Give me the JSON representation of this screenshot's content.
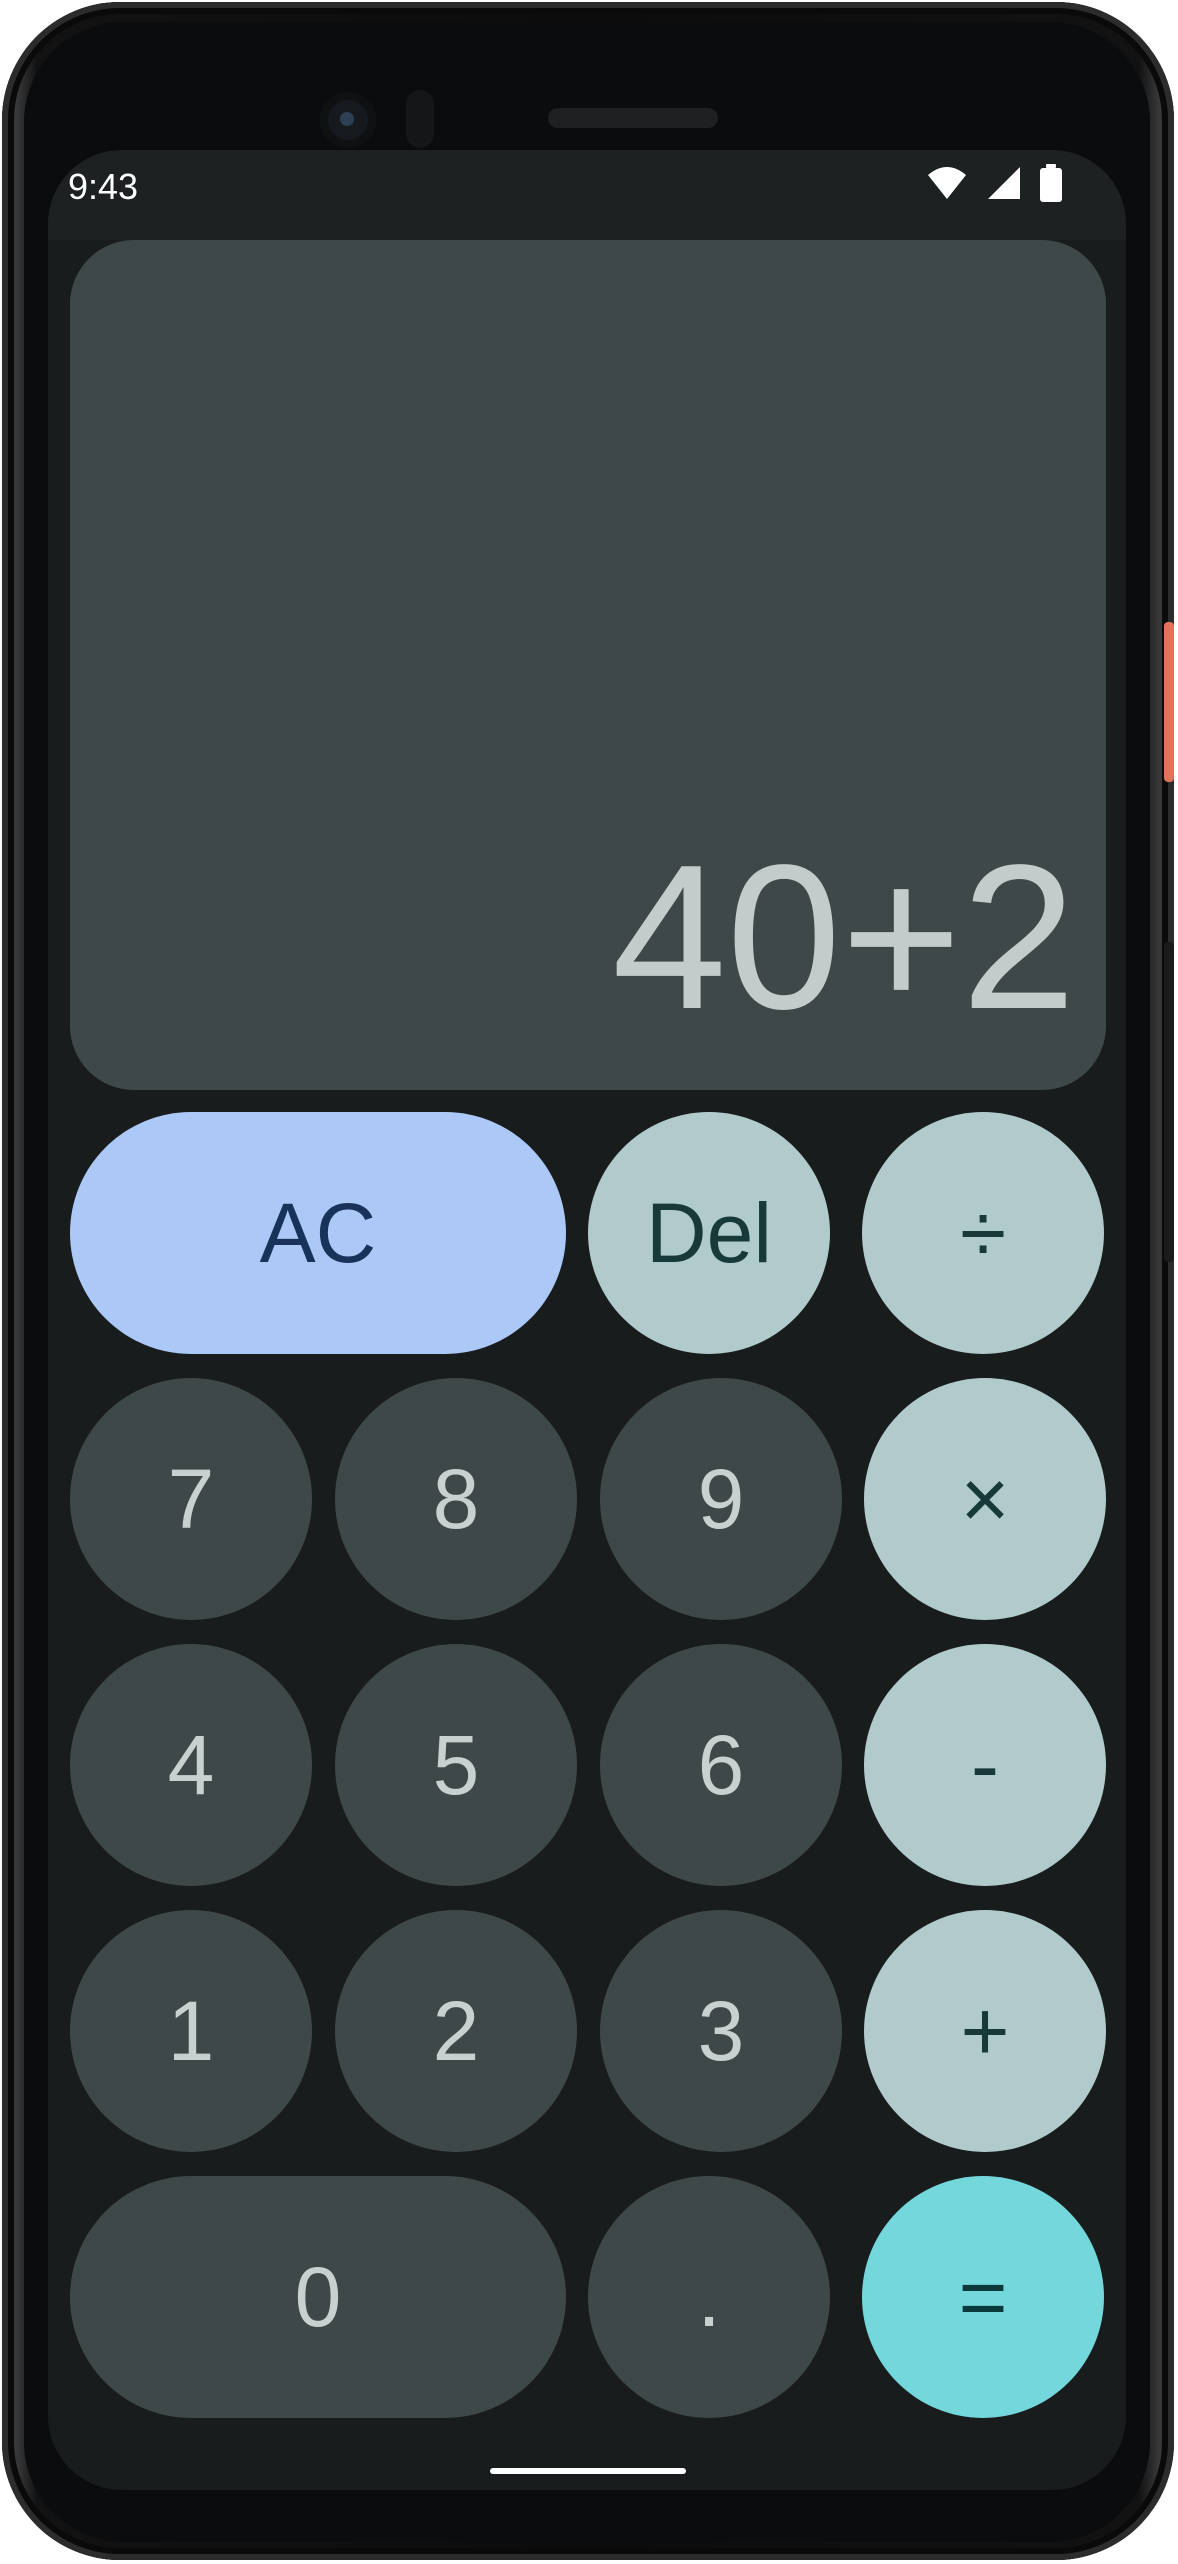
{
  "status_bar": {
    "time": "9:43",
    "icons": [
      "wifi-icon",
      "signal-icon",
      "battery-icon"
    ]
  },
  "display": {
    "expression": "40+2"
  },
  "keypad": {
    "ac": "AC",
    "del": "Del",
    "divide": "÷",
    "seven": "7",
    "eight": "8",
    "nine": "9",
    "multiply": "×",
    "four": "4",
    "five": "5",
    "six": "6",
    "minus": "-",
    "one": "1",
    "two": "2",
    "three": "3",
    "plus": "+",
    "zero": "0",
    "decimal": ".",
    "equals": "="
  },
  "colors": {
    "screen_background": "#191c1c",
    "display_background": "#3f4849",
    "number_key": "#3f4849",
    "operator_key": "#b1cbcc",
    "clear_key": "#abc8f6",
    "equals_key": "#73d7db"
  }
}
